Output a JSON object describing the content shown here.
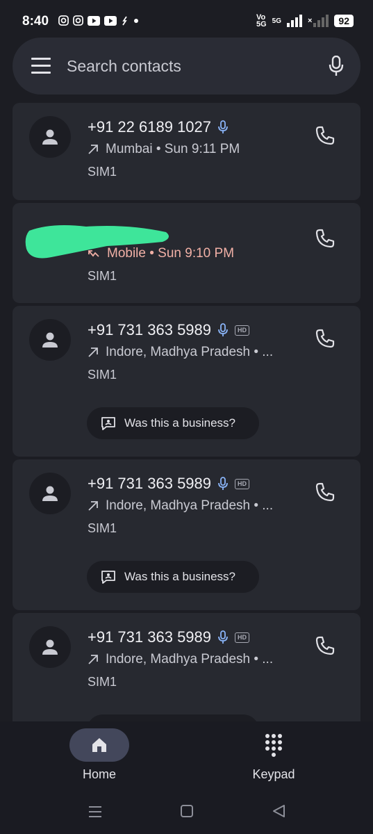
{
  "status_bar": {
    "time": "8:40",
    "battery": "92",
    "network_top": "Vo",
    "network_bottom": "5G",
    "network_type": "5G",
    "no_signal_mark": "×"
  },
  "search": {
    "placeholder": "Search contacts"
  },
  "calls": [
    {
      "number": "+91 22 6189 1027",
      "detail": "Mumbai • Sun 9:11 PM",
      "direction": "outgoing",
      "sim": "SIM1",
      "hd": false
    },
    {
      "number": "",
      "detail": "Mobile • Sun 9:10 PM",
      "direction": "missed",
      "sim": "SIM1",
      "hd": false
    },
    {
      "number": "+91 731 363 5989",
      "detail": "Indore, Madhya Pradesh • ...",
      "direction": "outgoing",
      "sim": "SIM1",
      "hd": true,
      "business_prompt": "Was this a business?"
    },
    {
      "number": "+91 731 363 5989",
      "detail": "Indore, Madhya Pradesh • ...",
      "direction": "outgoing",
      "sim": "SIM1",
      "hd": true,
      "business_prompt": "Was this a business?"
    },
    {
      "number": "+91 731 363 5989",
      "detail": "Indore, Madhya Pradesh • ...",
      "direction": "outgoing",
      "sim": "SIM1",
      "hd": true
    }
  ],
  "hd_label": "HD",
  "bottom_nav": {
    "home_label": "Home",
    "keypad_label": "Keypad"
  },
  "colors": {
    "background": "#1c1d23",
    "card": "#272930",
    "missed": "#f1b0a6",
    "mic_accent": "#8ab4f8",
    "redaction": "#3ee59a"
  }
}
